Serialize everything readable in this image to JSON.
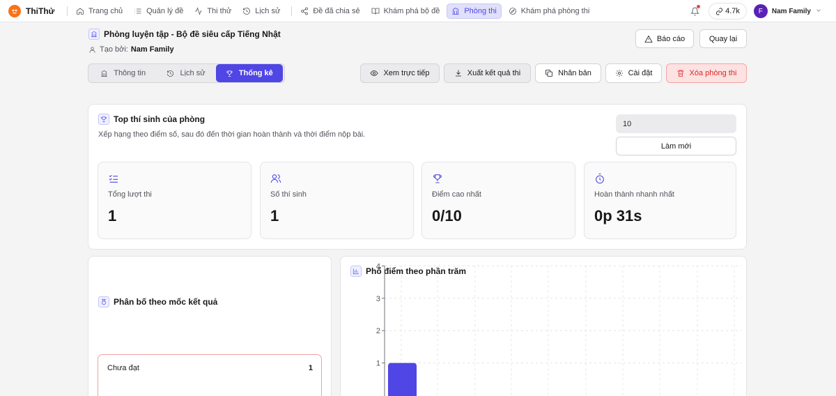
{
  "nav": {
    "brand": "ThiThử",
    "items": [
      {
        "label": "Trang chủ",
        "icon": "home-icon"
      },
      {
        "label": "Quản lý đề",
        "icon": "list-icon"
      },
      {
        "label": "Thi thử",
        "icon": "activity-icon"
      },
      {
        "label": "Lịch sử",
        "icon": "history-icon"
      },
      {
        "label": "Đề đã chia sẻ",
        "icon": "share-icon"
      },
      {
        "label": "Khám phá bộ đề",
        "icon": "book-open-icon"
      },
      {
        "label": "Phòng thi",
        "icon": "columns-icon",
        "active": true
      },
      {
        "label": "Khám phá phòng thi",
        "icon": "compass-icon"
      }
    ],
    "credits": "4.7k",
    "avatar_letter": "F",
    "user_name": "Nam Family"
  },
  "header": {
    "title": "Phòng luyện tập - Bộ đề siêu cấp Tiếng Nhật",
    "created_by_label": "Tạo bởi:",
    "creator": "Nam Family",
    "report_label": "Báo cáo",
    "back_label": "Quay lại"
  },
  "tabs": [
    {
      "label": "Thông tin",
      "icon": "columns-icon"
    },
    {
      "label": "Lịch sử",
      "icon": "history-icon"
    },
    {
      "label": "Thống kê",
      "icon": "trophy-icon",
      "active": true
    }
  ],
  "actions": {
    "watch_live": "Xem trực tiếp",
    "export": "Xuất kết quả thi",
    "clone": "Nhân bản",
    "settings": "Cài đặt",
    "delete": "Xóa phòng thi"
  },
  "top_section": {
    "title": "Top thí sinh của phòng",
    "description": "Xếp hạng theo điểm số, sau đó đến thời gian hoàn thành và thời điểm nộp bài.",
    "limit_value": "10",
    "refresh_label": "Làm mới"
  },
  "stats": [
    {
      "label": "Tổng lượt thi",
      "value": "1",
      "icon": "list-checks-icon"
    },
    {
      "label": "Số thí sinh",
      "value": "1",
      "icon": "users-icon"
    },
    {
      "label": "Điểm cao nhất",
      "value": "0/10",
      "icon": "trophy-icon"
    },
    {
      "label": "Hoàn thành nhanh nhất",
      "value": "0p 31s",
      "icon": "timer-icon"
    }
  ],
  "distribution": {
    "title": "Phân bố theo mốc kết quả",
    "outcomes": [
      {
        "label": "Chưa đạt",
        "count": "1"
      }
    ]
  },
  "histogram": {
    "title": "Phổ điểm theo phần trăm"
  },
  "chart_data": {
    "type": "bar",
    "title": "Phổ điểm theo phần trăm",
    "y_ticks": [
      "1",
      "2",
      "3",
      "4"
    ],
    "ylim": [
      0,
      4
    ],
    "grid": true,
    "bar_color": "#4f46e5",
    "values": [
      1
    ]
  },
  "colors": {
    "accent": "#4f46e5",
    "danger": "#dc2626",
    "brand": "#f97316"
  }
}
